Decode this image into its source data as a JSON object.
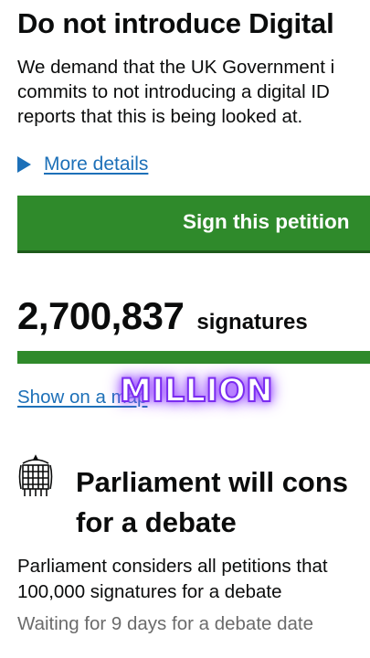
{
  "petition": {
    "title": "Do not introduce Digital",
    "summary_lines": [
      "We demand that the UK Government i",
      "commits to not introducing a digital ID",
      "reports that this is being looked at."
    ],
    "more_details": "More details",
    "sign_button": "Sign this petition",
    "signature_count": "2,700,837",
    "signature_label": "signatures",
    "progress_fraction": 1.0,
    "map_link": "Show on a map",
    "overlay_caption": "MILLION"
  },
  "parliament": {
    "heading_lines": [
      "Parliament will cons",
      "for a debate"
    ],
    "text_lines": [
      "Parliament considers all petitions that",
      "100,000 signatures for a debate"
    ],
    "waiting": "Waiting for 9 days for a debate date",
    "icon": "portcullis-icon"
  },
  "colors": {
    "brand_green": "#2f8a2b",
    "link_blue": "#1d70b8",
    "overlay_purple": "#7a2cf0"
  }
}
